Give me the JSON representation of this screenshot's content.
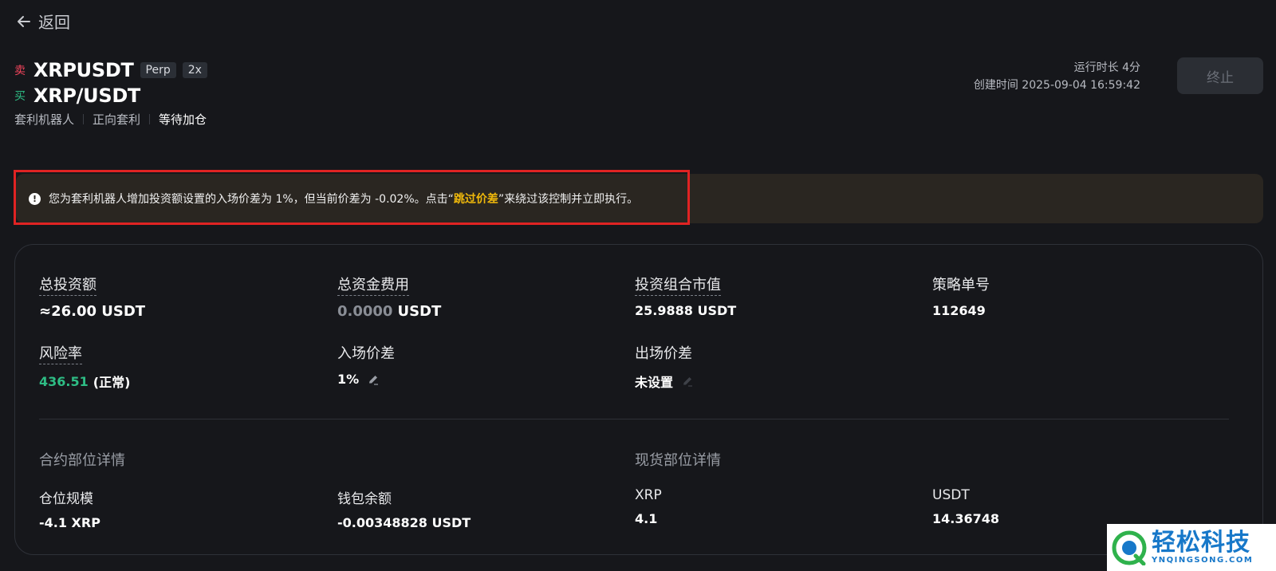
{
  "nav": {
    "back_label": "返回"
  },
  "header": {
    "sell_label": "卖",
    "sell_symbol": "XRPUSDT",
    "tags": [
      "Perp",
      "2x"
    ],
    "buy_label": "买",
    "buy_symbol": "XRP/USDT",
    "meta": [
      "套利机器人",
      "正向套利",
      "等待加仓"
    ],
    "run_time": "运行时长 4分",
    "created_time": "创建时间 2025-09-04 16:59:42",
    "stop_button": "终止"
  },
  "notice": {
    "text_before": "您为套利机器人增加投资额设置的入场价差为 1%，但当前价差为 -0.02%。点击“",
    "link": "跳过价差",
    "text_after": "”来绕过该控制并立即执行。"
  },
  "stats": {
    "total_investment": {
      "label": "总投资额",
      "value": "≈26.00 USDT"
    },
    "total_funding_fee": {
      "label": "总资金费用",
      "value_num": "0.0000",
      "value_unit": "USDT"
    },
    "portfolio_value": {
      "label": "投资组合市值",
      "value": "25.9888 USDT"
    },
    "strategy_id": {
      "label": "策略单号",
      "value": "112649"
    },
    "risk_rate": {
      "label": "风险率",
      "value_num": "436.51",
      "value_status": "(正常)"
    },
    "entry_spread": {
      "label": "入场价差",
      "value": "1%"
    },
    "exit_spread": {
      "label": "出场价差",
      "value": "未设置"
    }
  },
  "futures_section": {
    "title": "合约部位详情",
    "position_size": {
      "label": "仓位规模",
      "value": "-4.1 XRP"
    },
    "wallet_balance": {
      "label": "钱包余额",
      "value": "-0.00348828 USDT"
    }
  },
  "spot_section": {
    "title": "现货部位详情",
    "xrp": {
      "label": "XRP",
      "value": "4.1"
    },
    "usdt": {
      "label": "USDT",
      "value": "14.36748"
    }
  },
  "watermark": {
    "cn": "轻松科技",
    "en": "YNQINGSONG.COM"
  },
  "colors": {
    "sell": "#f6465d",
    "buy": "#2ebd85",
    "link": "#f0b90b",
    "highlight": "#e02323"
  }
}
